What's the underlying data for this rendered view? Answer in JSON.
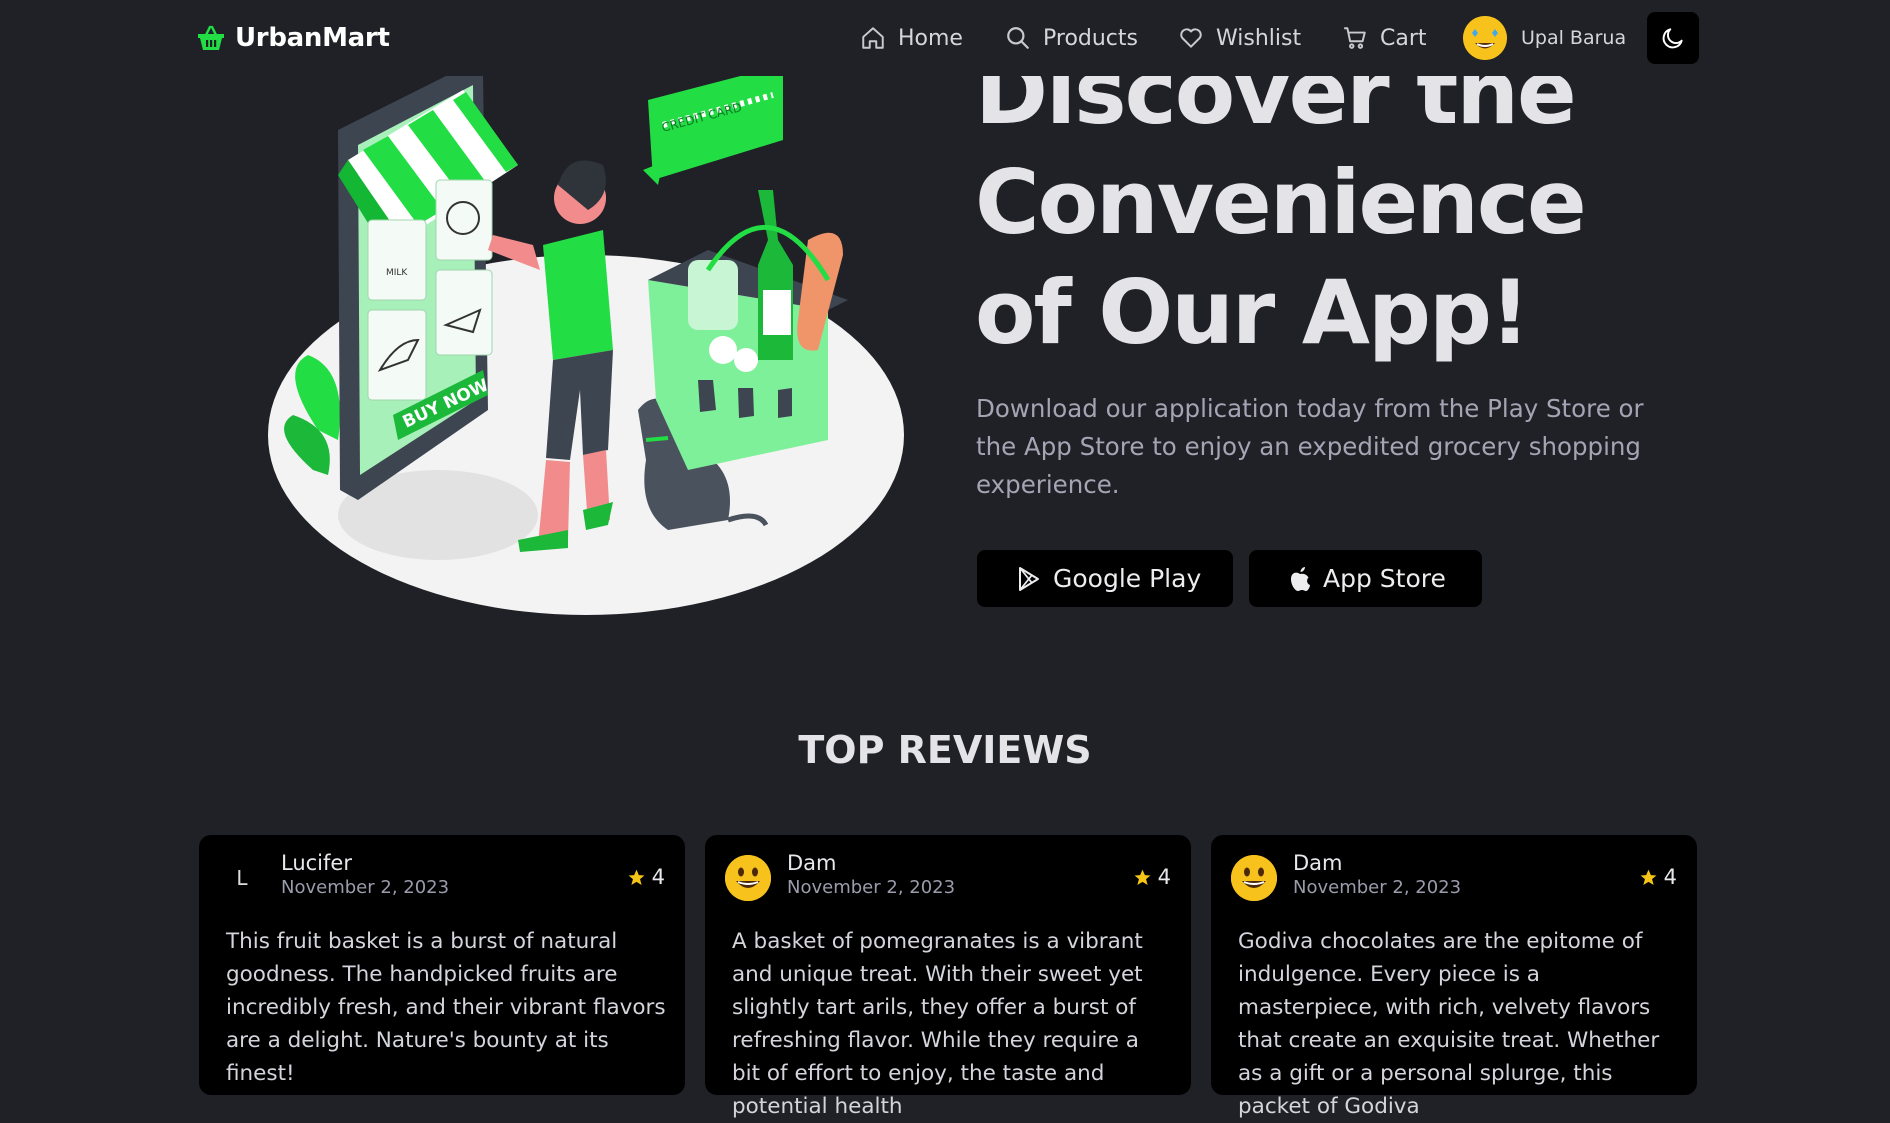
{
  "nav": {
    "brand": "UrbanMart",
    "items": [
      {
        "label": "Home",
        "icon": "home-icon"
      },
      {
        "label": "Products",
        "icon": "search-icon"
      },
      {
        "label": "Wishlist",
        "icon": "heart-icon"
      },
      {
        "label": "Cart",
        "icon": "cart-icon"
      }
    ],
    "user_name": "Upal Barua",
    "theme_icon": "moon-icon"
  },
  "hero": {
    "title": "Discover the Convenience of Our App!",
    "description": "Download our application today from the Play Store or the App Store to enjoy an expedited grocery shopping experience.",
    "buttons": [
      {
        "label": "Google Play",
        "icon": "google-play-icon"
      },
      {
        "label": "App Store",
        "icon": "apple-icon"
      }
    ],
    "illustration_labels": {
      "credit_card": "CREDIT CARD",
      "buy_now": "BUY NOW",
      "milk": "MILK"
    }
  },
  "reviews": {
    "title": "TOP REVIEWS",
    "items": [
      {
        "name": "Lucifer",
        "date": "November 2, 2023",
        "rating": "4",
        "avatar": "L",
        "text": "This fruit basket is a burst of natural goodness. The handpicked fruits are incredibly fresh, and their vibrant flavors are a delight. Nature's bounty at its finest!"
      },
      {
        "name": "Dam",
        "date": "November 2, 2023",
        "rating": "4",
        "avatar": "smiley-avatar",
        "text": "A basket of pomegranates is a vibrant and unique treat. With their sweet yet slightly tart arils, they offer a burst of refreshing flavor. While they require a bit of effort to enjoy, the taste and potential health"
      },
      {
        "name": "Dam",
        "date": "November 2, 2023",
        "rating": "4",
        "avatar": "smiley-avatar",
        "text": "Godiva chocolates are the epitome of indulgence. Every piece is a masterpiece, with rich, velvety flavors that create an exquisite treat. Whether as a gift or a personal splurge, this packet of Godiva"
      }
    ]
  },
  "colors": {
    "accent": "#22dd44",
    "background": "#202126",
    "card": "#000000",
    "star": "#f5c518"
  }
}
